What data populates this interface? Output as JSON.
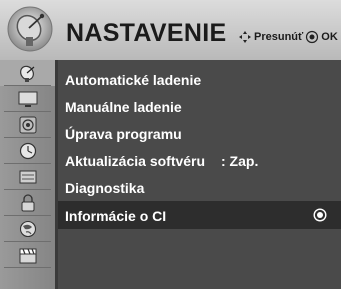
{
  "header": {
    "title": "NASTAVENIE",
    "hint_move": "Presunúť",
    "hint_ok": "OK",
    "icon": "satellite-dish-icon"
  },
  "sidebar": {
    "items": [
      {
        "icon": "satellite-dish-icon",
        "active": true
      },
      {
        "icon": "tv-screen-icon",
        "active": false
      },
      {
        "icon": "speaker-icon",
        "active": false
      },
      {
        "icon": "clock-icon",
        "active": false
      },
      {
        "icon": "lock-screen-icon",
        "active": false
      },
      {
        "icon": "padlock-icon",
        "active": false
      },
      {
        "icon": "globe-icon",
        "active": false
      },
      {
        "icon": "clapperboard-icon",
        "active": false
      }
    ]
  },
  "menu": {
    "items": [
      {
        "label": "Automatické ladenie",
        "value": ""
      },
      {
        "label": "Manuálne ladenie",
        "value": ""
      },
      {
        "label": "Úprava programu",
        "value": ""
      },
      {
        "label": "Aktualizácia softvéru",
        "value": ": Zap."
      },
      {
        "label": "Diagnostika",
        "value": ""
      },
      {
        "label": "Informácie o CI",
        "value": "",
        "selected": true
      }
    ]
  },
  "colors": {
    "header": "#c8c8c8",
    "menu_bg": "#4a4a4a",
    "selected_bg": "#2d2d2d",
    "text": "#ffffff"
  }
}
